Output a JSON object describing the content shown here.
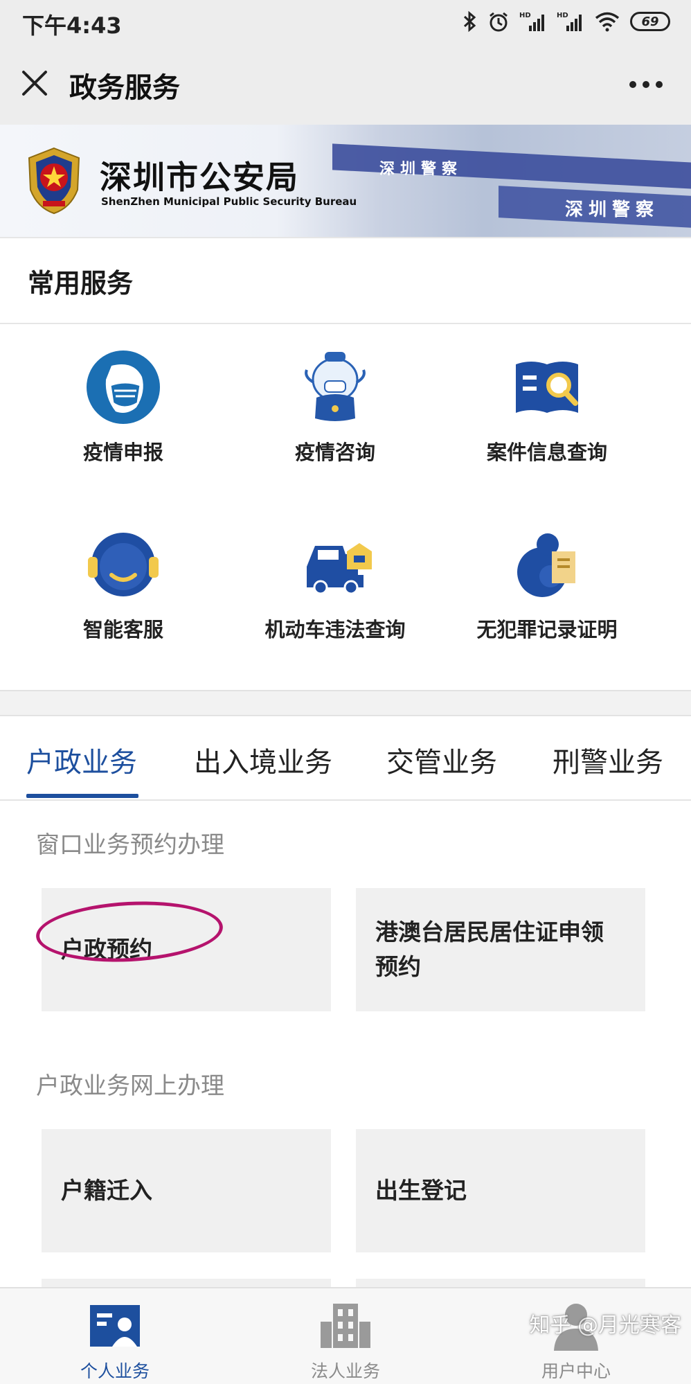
{
  "status_bar": {
    "time": "下午4:43",
    "battery": "69"
  },
  "nav": {
    "title": "政务服务"
  },
  "banner": {
    "org_name": "深圳市公安局",
    "org_name_en": "ShenZhen Municipal Public Security Bureau",
    "sign_text_1": "深圳警察",
    "sign_text_2": "深圳警察"
  },
  "common_services": {
    "title": "常用服务",
    "items": [
      {
        "label": "疫情申报",
        "icon": "mask-icon"
      },
      {
        "label": "疫情咨询",
        "icon": "mascot-icon"
      },
      {
        "label": "案件信息查询",
        "icon": "case-search-icon"
      },
      {
        "label": "智能客服",
        "icon": "headset-icon"
      },
      {
        "label": "机动车违法查询",
        "icon": "car-icon"
      },
      {
        "label": "无犯罪记录证明",
        "icon": "certificate-icon"
      }
    ]
  },
  "tabs": [
    {
      "label": "户政业务",
      "active": true
    },
    {
      "label": "出入境业务",
      "active": false
    },
    {
      "label": "交管业务",
      "active": false
    },
    {
      "label": "刑警业务",
      "active": false
    }
  ],
  "sections": [
    {
      "title": "窗口业务预约办理",
      "cards": [
        {
          "label": "户政预约"
        },
        {
          "label": "港澳台居民居住证申领预约"
        }
      ]
    },
    {
      "title": "户政业务网上办理",
      "cards": [
        {
          "label": "户籍迁入"
        },
        {
          "label": "出生登记"
        }
      ]
    }
  ],
  "bottom_nav": [
    {
      "label": "个人业务",
      "icon": "person-card-icon",
      "active": true
    },
    {
      "label": "法人业务",
      "icon": "building-icon",
      "active": false
    },
    {
      "label": "用户中心",
      "icon": "user-icon",
      "active": false
    }
  ],
  "watermark": "知乎 @月光寒客",
  "colors": {
    "accent": "#1d4f9e",
    "highlight_circle": "#b5136d"
  }
}
